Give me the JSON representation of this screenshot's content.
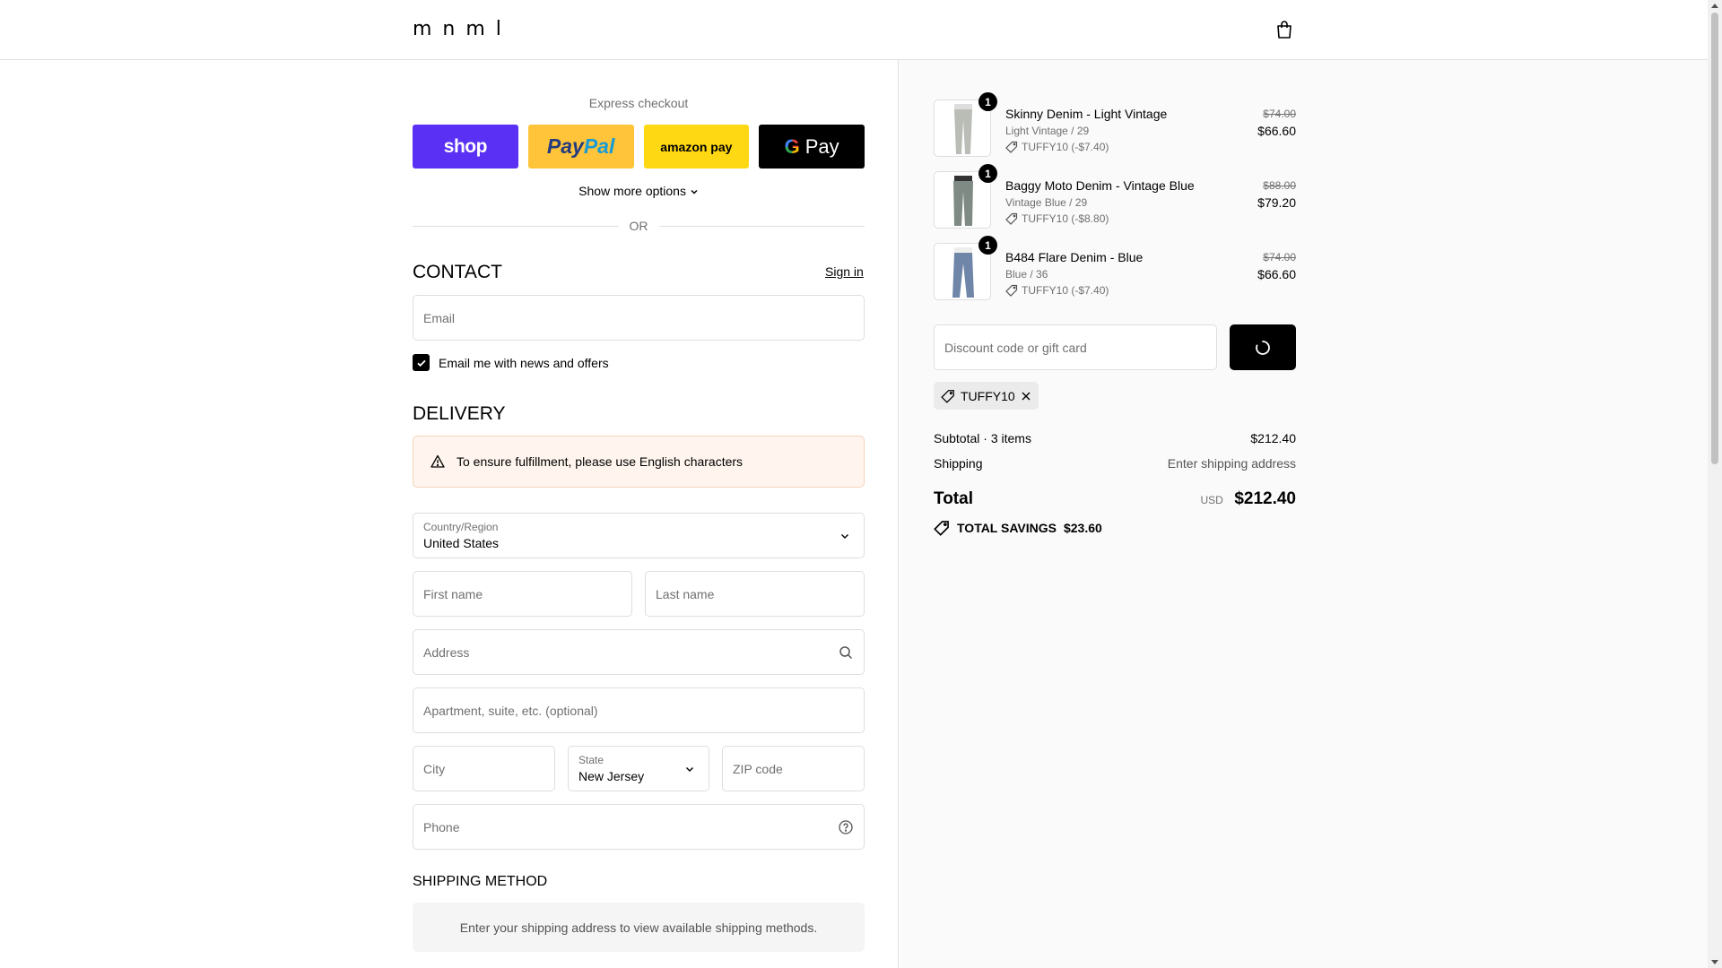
{
  "header": {
    "logo": "mnml",
    "cart_icon": "shopping-bag-icon"
  },
  "express": {
    "label": "Express checkout",
    "buttons": {
      "shop": "shop",
      "paypal_a": "Pay",
      "paypal_b": "Pal",
      "amazon": "amazon pay",
      "gpay_g": "G",
      "gpay": "Pay"
    },
    "show_more": "Show more options",
    "or": "OR"
  },
  "contact": {
    "title": "CONTACT",
    "sign_in": "Sign in",
    "email_placeholder": "Email",
    "newsletter_label": "Email me with news and offers",
    "newsletter_checked": true
  },
  "delivery": {
    "title": "DELIVERY",
    "warning": "To ensure fulfillment, please use English characters",
    "country_label": "Country/Region",
    "country_value": "United States",
    "first_name": "First name",
    "last_name": "Last name",
    "address": "Address",
    "apartment": "Apartment, suite, etc. (optional)",
    "city": "City",
    "state_label": "State",
    "state_value": "New Jersey",
    "zip": "ZIP code",
    "phone": "Phone"
  },
  "shipping_method": {
    "title": "SHIPPING METHOD",
    "message": "Enter your shipping address to view available shipping methods."
  },
  "cart": {
    "items": [
      {
        "qty": "1",
        "name": "Skinny Denim - Light Vintage",
        "variant": "Light Vintage / 29",
        "discount": "TUFFY10 (-$7.40)",
        "old_price": "$74.00",
        "price": "$66.60",
        "color": "#b9bdb6"
      },
      {
        "qty": "1",
        "name": "Baggy Moto Denim - Vintage Blue",
        "variant": "Vintage Blue / 29",
        "discount": "TUFFY10 (-$8.80)",
        "old_price": "$88.00",
        "price": "$79.20",
        "color": "#7f8a84"
      },
      {
        "qty": "1",
        "name": "B484 Flare Denim - Blue",
        "variant": "Blue / 36",
        "discount": "TUFFY10 (-$7.40)",
        "old_price": "$74.00",
        "price": "$66.60",
        "color": "#6f86a8"
      }
    ],
    "discount_placeholder": "Discount code or gift card",
    "applied_code": "TUFFY10",
    "subtotal_label": "Subtotal · 3 items",
    "subtotal_value": "$212.40",
    "shipping_label": "Shipping",
    "shipping_value": "Enter shipping address",
    "total_label": "Total",
    "total_currency": "USD",
    "total_value": "$212.40",
    "savings_label": "TOTAL SAVINGS",
    "savings_value": "$23.60"
  }
}
